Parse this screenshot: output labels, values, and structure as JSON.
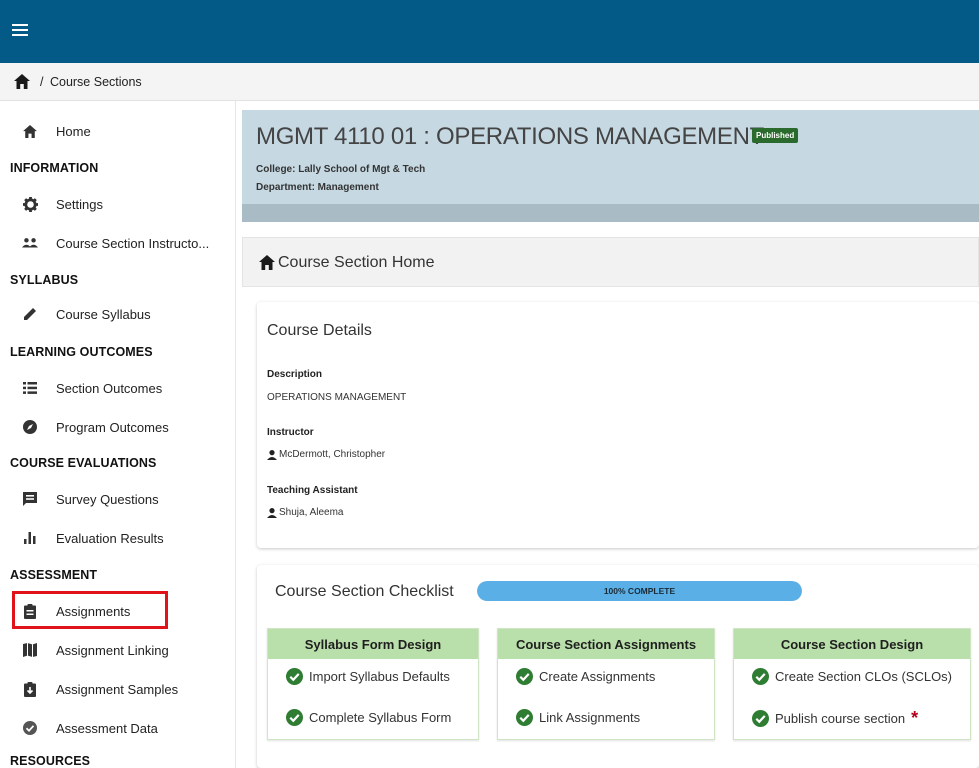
{
  "breadcrumb": {
    "separator": "/",
    "current": "Course Sections"
  },
  "sidebar": {
    "home": "Home",
    "sections": {
      "information": "INFORMATION",
      "syllabus": "SYLLABUS",
      "learning_outcomes": "LEARNING OUTCOMES",
      "course_evaluations": "COURSE EVALUATIONS",
      "assessment": "ASSESSMENT",
      "resources": "RESOURCES"
    },
    "items": {
      "settings": "Settings",
      "instructors": "Course Section Instructo...",
      "course_syllabus": "Course Syllabus",
      "section_outcomes": "Section Outcomes",
      "program_outcomes": "Program Outcomes",
      "survey_questions": "Survey Questions",
      "evaluation_results": "Evaluation Results",
      "assignments": "Assignments",
      "assignment_linking": "Assignment Linking",
      "assignment_samples": "Assignment Samples",
      "assessment_data": "Assessment Data"
    }
  },
  "header": {
    "title": "MGMT 4110 01 : OPERATIONS MANAGEMENT",
    "badge": "Published",
    "college": "College: Lally School of Mgt & Tech",
    "department": "Department: Management"
  },
  "section_home": {
    "title": "Course Section Home"
  },
  "details": {
    "title": "Course Details",
    "description_label": "Description",
    "description": "OPERATIONS MANAGEMENT",
    "instructor_label": "Instructor",
    "instructor": "McDermott, Christopher",
    "ta_label": "Teaching Assistant",
    "ta": "Shuja, Aleema"
  },
  "checklist": {
    "title": "Course Section Checklist",
    "progress_label": "100% COMPLETE",
    "progress_percent": 100,
    "columns": [
      {
        "heading": "Syllabus Form Design",
        "items": [
          "Import Syllabus Defaults",
          "Complete Syllabus Form"
        ]
      },
      {
        "heading": "Course Section Assignments",
        "items": [
          "Create Assignments",
          "Link Assignments"
        ]
      },
      {
        "heading": "Course Section Design",
        "items": [
          "Create Section CLOs (SCLOs)",
          "Publish course section"
        ],
        "required_marker": "*"
      }
    ]
  },
  "colors": {
    "topbar": "#035a86",
    "header_bg": "#c6d9e3",
    "badge": "#2a6a2c",
    "checklist_head": "#b9dfaa",
    "check": "#2e7d32",
    "progress": "#5ab0e6",
    "highlight": "#e0131b",
    "required": "#b3001b"
  },
  "icons": {
    "menu": "hamburger-icon",
    "home": "home-icon",
    "settings": "gear-icon",
    "instructors": "people-icon",
    "syllabus": "pencil-icon",
    "section_outcomes": "list-icon",
    "program_outcomes": "compass-icon",
    "survey": "comment-box-icon",
    "evaluation": "bar-chart-icon",
    "assignments": "clipboard-icon",
    "linking": "map-icon",
    "samples": "folder-sample-icon",
    "assessment_data": "check-circle-icon",
    "person": "person-icon",
    "check": "check-circle-icon"
  }
}
